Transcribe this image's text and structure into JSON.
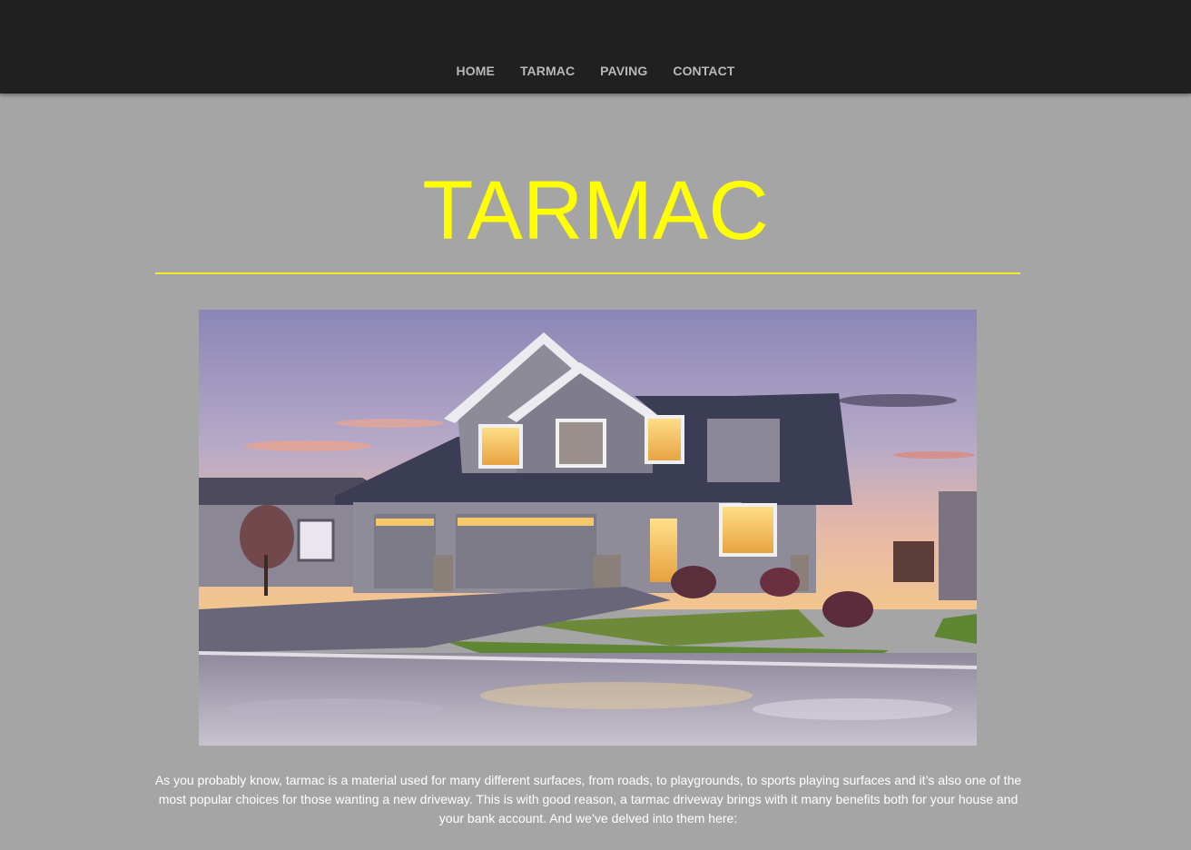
{
  "nav": {
    "items": [
      {
        "label": "HOME"
      },
      {
        "label": "TARMAC"
      },
      {
        "label": "PAVING"
      },
      {
        "label": "CONTACT"
      }
    ]
  },
  "page": {
    "title": "TARMAC",
    "intro": "As you probably know, tarmac is a material used for many different surfaces, from roads, to playgrounds, to sports playing surfaces and it’s also one of the most popular choices for those wanting a new driveway. This is with good reason, a tarmac driveway brings with it many benefits both for your house and your bank account. And we’ve delved into them here:"
  },
  "colors": {
    "header_bg": "#202020",
    "page_bg": "#a5a5a5",
    "accent": "#ffff00",
    "nav_text": "#b8b8b8"
  }
}
